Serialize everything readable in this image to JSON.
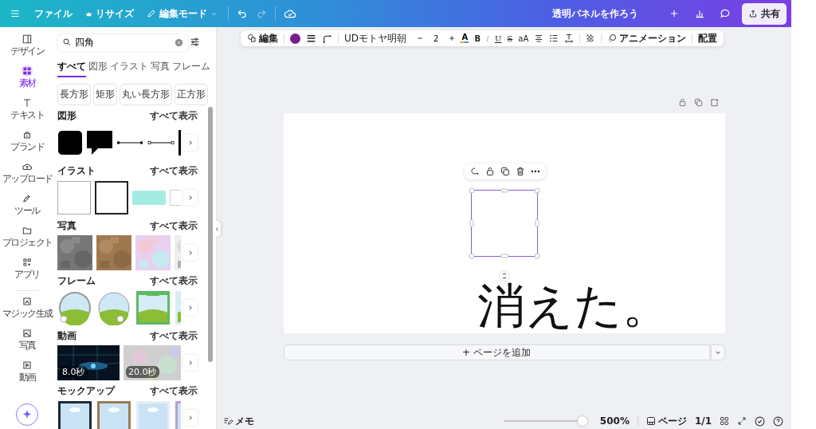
{
  "header": {
    "menu": [
      {
        "label": "ファイル"
      },
      {
        "label": "リサイズ"
      },
      {
        "label": "編集モード"
      }
    ],
    "title": "透明パネルを作ろう",
    "share": "共有"
  },
  "text_toolbar": {
    "edit": "編集",
    "color": "#7b1c8c",
    "font": "UDモトヤ明朝",
    "font_size": "2",
    "text_color": "A",
    "format": [
      {
        "label": "B",
        "disabled": false
      },
      {
        "label": "I",
        "disabled": true
      },
      {
        "label": "U",
        "disabled": false
      },
      {
        "label": "S",
        "disabled": false
      },
      {
        "label": "aA",
        "disabled": false
      }
    ],
    "animation": "アニメーション",
    "position": "配置"
  },
  "rail": [
    {
      "label": "デザイン",
      "selected": false
    },
    {
      "label": "素材",
      "selected": true
    },
    {
      "label": "テキスト",
      "selected": false
    },
    {
      "label": "ブランド",
      "selected": false
    },
    {
      "label": "アップロード",
      "selected": false
    },
    {
      "label": "ツール",
      "selected": false
    },
    {
      "label": "プロジェクト",
      "selected": false
    },
    {
      "label": "アプリ",
      "selected": false
    },
    {
      "label": "マジック生成",
      "selected": false
    },
    {
      "label": "写真",
      "selected": false
    },
    {
      "label": "動画",
      "selected": false
    }
  ],
  "search": {
    "value": "四角"
  },
  "tabs": [
    {
      "label": "すべて",
      "selected": true
    },
    {
      "label": "図形",
      "selected": false
    },
    {
      "label": "イラスト",
      "selected": false
    },
    {
      "label": "写真",
      "selected": false
    },
    {
      "label": "フレーム",
      "selected": false
    }
  ],
  "chips": [
    "長方形",
    "矩形",
    "丸い長方形",
    "正方形"
  ],
  "sections": [
    {
      "title": "図形",
      "see_all": "すべて表示",
      "kind": "shapes"
    },
    {
      "title": "イラスト",
      "see_all": "すべて表示",
      "kind": "illustrations"
    },
    {
      "title": "写真",
      "see_all": "すべて表示",
      "kind": "photos"
    },
    {
      "title": "フレーム",
      "see_all": "すべて表示",
      "kind": "frames"
    },
    {
      "title": "動画",
      "see_all": "すべて表示",
      "kind": "videos",
      "durations": [
        "8.0秒",
        "20.0秒"
      ]
    },
    {
      "title": "モックアップ",
      "see_all": "すべて表示",
      "kind": "mockups"
    }
  ],
  "canvas": {
    "text": "消えた。",
    "add_page": "+ ページを追加"
  },
  "footer": {
    "notes": "メモ",
    "zoom": {
      "level": 0.95
    },
    "zoom_reading": "500%",
    "pages": "ページ",
    "page_count": "1/1"
  }
}
